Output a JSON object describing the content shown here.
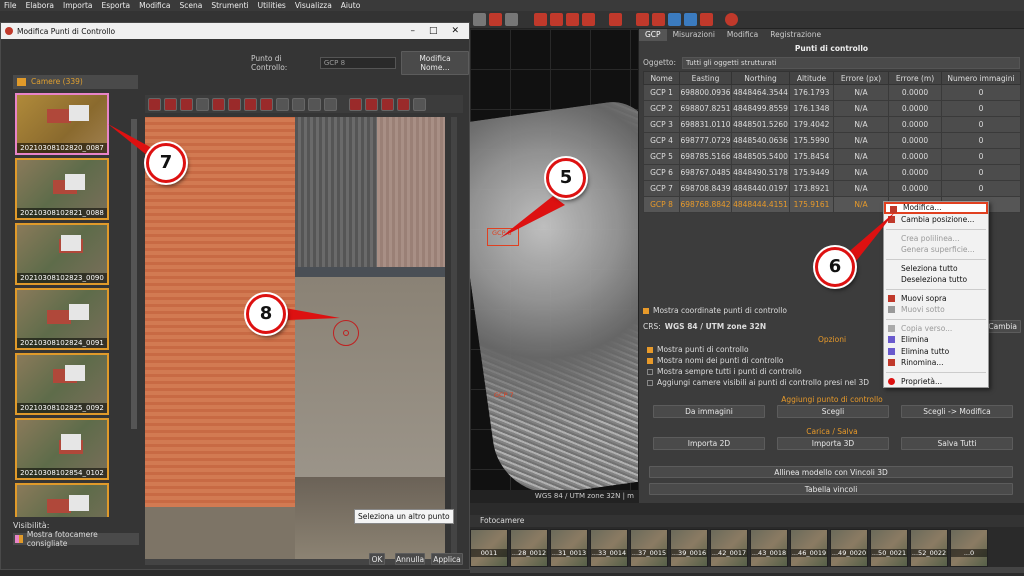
{
  "menubar": [
    "File",
    "Elabora",
    "Importa",
    "Esporta",
    "Modifica",
    "Scena",
    "Strumenti",
    "Utilities",
    "Visualizza",
    "Aiuto"
  ],
  "dialog": {
    "title": "Modifica Punti di Controllo",
    "control_point_label": "Punto di Controllo:",
    "control_point_value": "GCP 8",
    "rename_button": "Modifica Nome...",
    "cameras_header": "Camere (339)",
    "thumbnails": [
      "20210308102820_0087",
      "20210308102821_0088",
      "20210308102823_0090",
      "20210308102824_0091",
      "20210308102825_0092",
      "20210308102854_0102",
      ""
    ],
    "visibility_label": "Visibilità:",
    "suggested_cameras": "Mostra fotocamere consigliate",
    "select_tip": "Seleziona un altro punto",
    "ok": "OK",
    "cancel": "Annulla",
    "apply": "Applica"
  },
  "viewport": {
    "status": "WGS 84 / UTM zone 32N | m",
    "gcp8_label": "GCP 8",
    "gcp7_label": "GCP 7"
  },
  "panel": {
    "tabs": [
      "GCP",
      "Misurazioni",
      "Modifica",
      "Registrazione"
    ],
    "title": "Punti di controllo",
    "object_label": "Oggetto:",
    "object_value": "Tutti gli oggetti strutturati",
    "columns": [
      "Nome",
      "Easting",
      "Northing",
      "Altitude",
      "Errore (px)",
      "Errore (m)",
      "Numero immagini"
    ],
    "rows": [
      [
        "GCP 1",
        "698800.0936",
        "4848464.3544",
        "176.1793",
        "N/A",
        "0.0000",
        "0"
      ],
      [
        "GCP 2",
        "698807.8251",
        "4848499.8559",
        "176.1348",
        "N/A",
        "0.0000",
        "0"
      ],
      [
        "GCP 3",
        "698831.0110",
        "4848501.5260",
        "179.4042",
        "N/A",
        "0.0000",
        "0"
      ],
      [
        "GCP 4",
        "698777.0729",
        "4848540.0636",
        "175.5990",
        "N/A",
        "0.0000",
        "0"
      ],
      [
        "GCP 5",
        "698785.5166",
        "4848505.5400",
        "175.8454",
        "N/A",
        "0.0000",
        "0"
      ],
      [
        "GCP 6",
        "698767.0485",
        "4848490.5178",
        "175.9449",
        "N/A",
        "0.0000",
        "0"
      ],
      [
        "GCP 7",
        "698708.8439",
        "4848440.0197",
        "173.8921",
        "N/A",
        "0.0000",
        "0"
      ],
      [
        "GCP 8",
        "698768.8842",
        "4848444.4151",
        "175.9161",
        "N/A",
        "",
        ""
      ]
    ],
    "show_coords": "Mostra coordinate punti di controllo",
    "crs_label": "CRS:",
    "crs_value": "WGS 84 / UTM zone 32N",
    "change_button": "Cambia",
    "options_title": "Opzioni",
    "options": [
      {
        "label": "Mostra punti di controllo",
        "on": true
      },
      {
        "label": "Mostra nomi dei punti di controllo",
        "on": true
      },
      {
        "label": "Mostra sempre tutti i punti di controllo",
        "on": false
      },
      {
        "label": "Aggiungi camere visibili ai punti di controllo presi nel 3D",
        "on": false
      }
    ],
    "add_title": "Aggiungi punto di controllo",
    "add_buttons": [
      "Da immagini",
      "Scegli",
      "Scegli -> Modifica"
    ],
    "load_title": "Carica / Salva",
    "load_buttons": [
      "Importa 2D",
      "Importa 3D",
      "Salva Tutti"
    ],
    "align_button": "Allinea modello con Vincoli 3D",
    "constraints_button": "Tabella vincoli"
  },
  "context_menu": [
    {
      "label": "Modifica...",
      "state": "highlight"
    },
    {
      "label": "Cambia posizione...",
      "state": "enabled"
    },
    {
      "sep": true
    },
    {
      "label": "Crea polilinea...",
      "state": "disabled"
    },
    {
      "label": "Genera superficie...",
      "state": "disabled"
    },
    {
      "sep": true
    },
    {
      "label": "Seleziona tutto",
      "state": "enabled"
    },
    {
      "label": "Deseleziona tutto",
      "state": "enabled"
    },
    {
      "sep": true
    },
    {
      "label": "Muovi sopra",
      "state": "enabled"
    },
    {
      "label": "Muovi sotto",
      "state": "disabled"
    },
    {
      "sep": true
    },
    {
      "label": "Copia verso...",
      "state": "disabled"
    },
    {
      "label": "Elimina",
      "state": "enabled"
    },
    {
      "label": "Elimina tutto",
      "state": "enabled"
    },
    {
      "label": "Rinomina...",
      "state": "enabled"
    },
    {
      "sep": true
    },
    {
      "label": "Proprietà...",
      "state": "enabled"
    }
  ],
  "callouts": [
    "5",
    "6",
    "7",
    "8"
  ],
  "strip": {
    "header": "Fotocamere",
    "items": [
      "0011",
      "...28_0012",
      "...31_0013",
      "...33_0014",
      "...37_0015",
      "...39_0016",
      "...42_0017",
      "...43_0018",
      "...46_0019",
      "...49_0020",
      "...50_0021",
      "...52_0022",
      "...0"
    ]
  },
  "colors": {
    "accent": "#e89a2a",
    "callout_red": "#d11111"
  }
}
